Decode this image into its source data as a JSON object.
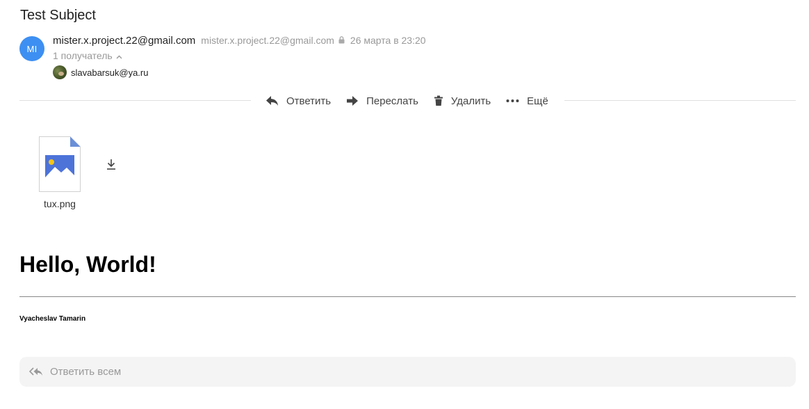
{
  "message": {
    "subject": "Test Subject",
    "sender": {
      "initials": "MI",
      "name": "mister.x.project.22@gmail.com",
      "email": "mister.x.project.22@gmail.com",
      "avatar_color": "#3d8ff2"
    },
    "date": "26 марта в 23:20",
    "recipients_toggle": "1 получатель",
    "recipients": [
      {
        "email": "slavabarsuk@ya.ru",
        "icon": "avatar-photo"
      }
    ]
  },
  "toolbar": {
    "reply": "Ответить",
    "forward": "Переслать",
    "delete": "Удалить",
    "more": "Ещё"
  },
  "attachment": {
    "name": "tux.png",
    "icon": "image-file-icon"
  },
  "body": {
    "heading": "Hello, World!",
    "signature": "Vyacheslav Tamarin"
  },
  "footer": {
    "reply_all": "Ответить всем"
  }
}
